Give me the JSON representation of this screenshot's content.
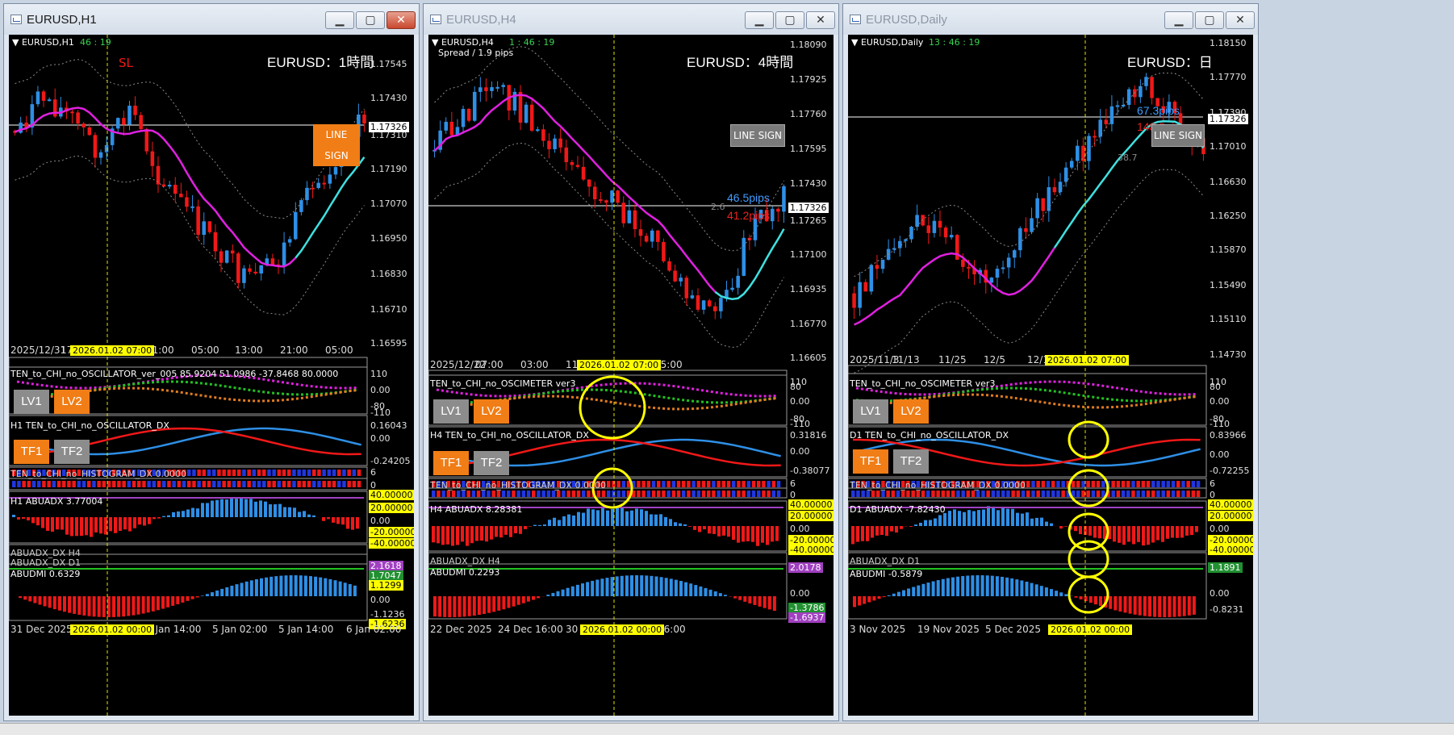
{
  "windows": [
    {
      "title": "EURUSD,H1",
      "active": true,
      "symbol_label": "EURUSD,H1",
      "clock": "46 : 19",
      "header": "EURUSD：1時間",
      "line_sign": "LINE SIGN",
      "sl_label": "SL",
      "price_axis": [
        "1.17545",
        "1.17430",
        "1.17310",
        "1.17190",
        "1.17070",
        "1.16950",
        "1.16830",
        "1.16710",
        "1.16595"
      ],
      "current_price": "1.17326",
      "time_axis": [
        "2025/12/31",
        "17:",
        "21:00",
        "05:00",
        "13:00",
        "21:00",
        "05:00"
      ],
      "vline_label": "2026.01.02 07:00",
      "bottom_axis": [
        "31 Dec 2025",
        "2 Jan 14:00",
        "5 Jan 02:00",
        "5 Jan 14:00",
        "6 Jan 02:00"
      ],
      "bottom_vline_label": "2026.01.02 00:00",
      "osc_title": "TEN_to_CHI_no_OSCILLATOR_ver_005 85.9204 51.0986 -37.8468 80.0000",
      "osc_axis": [
        "110",
        "0.00",
        "-80",
        "-110"
      ],
      "lv1": "LV1",
      "lv2": "LV2",
      "dx_title": "H1 TEN_to_CHI_no_OSCILLATOR_DX",
      "dx_axis": [
        "0.16043",
        "0.00",
        "-0.24205"
      ],
      "tf1": "TF1",
      "tf2": "TF2",
      "hist_title": "TEN_to_CHI_no_HISTOGRAM_DX 0.0000",
      "hist_axis": [
        "6",
        "0"
      ],
      "abuadx_title": "H1 ABUADX  3.77004",
      "abuadx_axis": [
        "40.00000",
        "20.00000",
        "0.00",
        "-20.00000",
        "-40.00000"
      ],
      "abuadx_h4": "ABUADX_DX H4",
      "abuadx_d1": "ABUADX_DX D1",
      "abudmi_title": "ABUDMI  0.6329",
      "abudmi_axis": [
        "2.1618",
        "1.7047",
        "1.1299",
        "0.00",
        "-1.1236",
        "-1.6236"
      ]
    },
    {
      "title": "EURUSD,H4",
      "active": false,
      "symbol_label": "EURUSD,H4",
      "clock": "1 : 46 : 19",
      "spread": "Spread / 1.9 pips",
      "header": "EURUSD：4時間",
      "line_sign": "LINE SIGN",
      "pips_blue": "46.5pips",
      "pips_red": "41.2pips",
      "small_val": "2.6",
      "price_axis": [
        "1.18090",
        "1.17925",
        "1.17760",
        "1.17595",
        "1.17430",
        "1.17265",
        "1.17100",
        "1.16935",
        "1.16770",
        "1.16605"
      ],
      "current_price": "1.17326",
      "time_axis": [
        "2025/12/22",
        "07:00",
        "03:00",
        "11",
        "15:00"
      ],
      "vline_label": "2026.01.02 07:00",
      "bottom_axis": [
        "22 Dec 2025",
        "24 Dec 16:00",
        "30",
        "16:00"
      ],
      "bottom_vline_label": "2026.01.02 00:00",
      "osc_title": "TEN_to_CHI_no_OSCIMETER ver3",
      "osc_axis": [
        "110",
        "80",
        "0.00",
        "-80",
        "-110"
      ],
      "lv1": "LV1",
      "lv2": "LV2",
      "dx_title": "H4 TEN_to_CHI_no_OSCILLATOR_DX",
      "dx_axis": [
        "0.31816",
        "0.00",
        "-0.38077"
      ],
      "tf1": "TF1",
      "tf2": "TF2",
      "hist_title": "TEN_to_CHI_no_HISTOGRAM_DX 0.0000",
      "hist_axis": [
        "6",
        "0"
      ],
      "abuadx_title": "H4 ABUADX  8.28381",
      "abuadx_axis": [
        "40.00000",
        "20.00000",
        "0.00",
        "-20.00000",
        "-40.00000"
      ],
      "abuadx_h4": "ABUADX_DX H4",
      "abudmi_title": "ABUDMI  0.2293",
      "abudmi_axis": [
        "2.0178",
        "0.00",
        "-1.3786",
        "-1.6937"
      ]
    },
    {
      "title": "EURUSD,Daily",
      "active": false,
      "symbol_label": "EURUSD,Daily",
      "clock": "13 : 46 : 19",
      "header": "EURUSD：日",
      "line_sign": "LINE SIGN",
      "pips_blue": "67.3pips",
      "pips_red": "148.8pips",
      "small_val": "38.7",
      "price_axis": [
        "1.18150",
        "1.17770",
        "1.17390",
        "1.17010",
        "1.16630",
        "1.16250",
        "1.15870",
        "1.15490",
        "1.15110",
        "1.14730"
      ],
      "current_price": "1.17326",
      "time_axis": [
        "2025/11/3",
        "11/13",
        "11/25",
        "12/5",
        "12/1"
      ],
      "vline_label": "2026.01.02 07:00",
      "bottom_axis": [
        "3 Nov 2025",
        "19 Nov 2025",
        "5 Dec 2025"
      ],
      "bottom_vline_label": "2026.01.02 00:00",
      "osc_title": "TEN_to_CHI_no_OSCIMETER ver3",
      "osc_axis": [
        "110",
        "80",
        "0.00",
        "-80",
        "-110"
      ],
      "lv1": "LV1",
      "lv2": "LV2",
      "dx_title": "D1 TEN_to_CHI_no_OSCILLATOR_DX",
      "dx_axis": [
        "0.83966",
        "0.00",
        "-0.72255"
      ],
      "tf1": "TF1",
      "tf2": "TF2",
      "hist_title": "TEN_to_CHI_no_HISTOGRAM_DX 0.0000",
      "hist_axis": [
        "6",
        "0"
      ],
      "abuadx_title": "D1 ABUADX  -7.82430",
      "abuadx_axis": [
        "40.00000",
        "20.00000",
        "0.00",
        "-20.00000",
        "-40.00000"
      ],
      "abuadx_d1": "ABUADX_DX D1",
      "abudmi_title": "ABUDMI  -0.5879",
      "abudmi_axis": [
        "1.1891",
        "0.00",
        "-0.8231"
      ]
    }
  ],
  "colors": {
    "bull": "#2e8fe6",
    "bear": "#f01818",
    "ma_fast": "#e020e0",
    "ma_slow": "#40e0e0",
    "vline": "#e0e000",
    "accent": "#f07d16"
  }
}
